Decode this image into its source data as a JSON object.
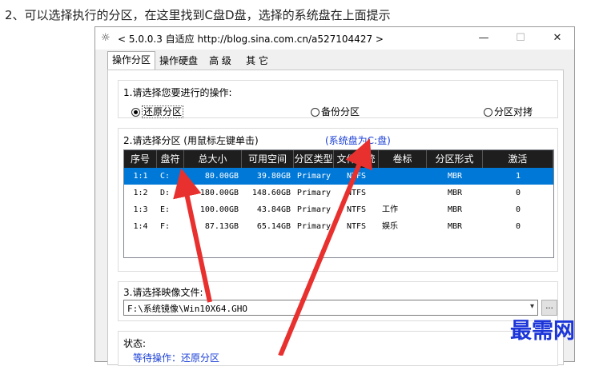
{
  "caption": "2、可以选择执行的分区，在这里找到C盘D盘，选择的系统盘在上面提示",
  "window": {
    "title": "< 5.0.0.3 自适应 http://blog.sina.com.cn/a527104427 >",
    "minimize": "—",
    "maximize": "☐",
    "close": "✕"
  },
  "tabs": [
    "操作分区",
    "操作硬盘",
    "高 级",
    "其 它"
  ],
  "operation": {
    "label": "1.请选择您要进行的操作:",
    "options": [
      "还原分区",
      "备份分区",
      "分区对拷"
    ],
    "selected_index": 0
  },
  "partition": {
    "label": "2.请选择分区 (用鼠标左键单击)",
    "hint": "(系统盘为C:盘)",
    "columns": [
      "序号",
      "盘符",
      "总大小",
      "可用空间",
      "分区类型",
      "文件系统",
      "卷标",
      "分区形式",
      "激活"
    ],
    "rows": [
      [
        "1:1",
        "C:",
        "80.00GB",
        "39.80GB",
        "Primary",
        "NTFS",
        "",
        "MBR",
        "1"
      ],
      [
        "1:2",
        "D:",
        "180.00GB",
        "148.60GB",
        "Primary",
        "NTFS",
        "",
        "MBR",
        "0"
      ],
      [
        "1:3",
        "E:",
        "100.00GB",
        "43.84GB",
        "Primary",
        "NTFS",
        "工作",
        "MBR",
        "0"
      ],
      [
        "1:4",
        "F:",
        "87.13GB",
        "65.14GB",
        "Primary",
        "NTFS",
        "娱乐",
        "MBR",
        "0"
      ]
    ],
    "selected_row": 0
  },
  "image_file": {
    "label": "3.请选择映像文件:",
    "value": "F:\\系统镜像\\Win10X64.GHO",
    "browse_label": "..."
  },
  "status": {
    "label": "状态:",
    "text": "等待操作：还原分区"
  },
  "watermark": "最需网",
  "colors": {
    "selection": "#0078d7",
    "header": "#1e1e1e",
    "hint": "#1a3fd6",
    "arrow": "#e8312f",
    "watermark": "#1b35d9"
  }
}
